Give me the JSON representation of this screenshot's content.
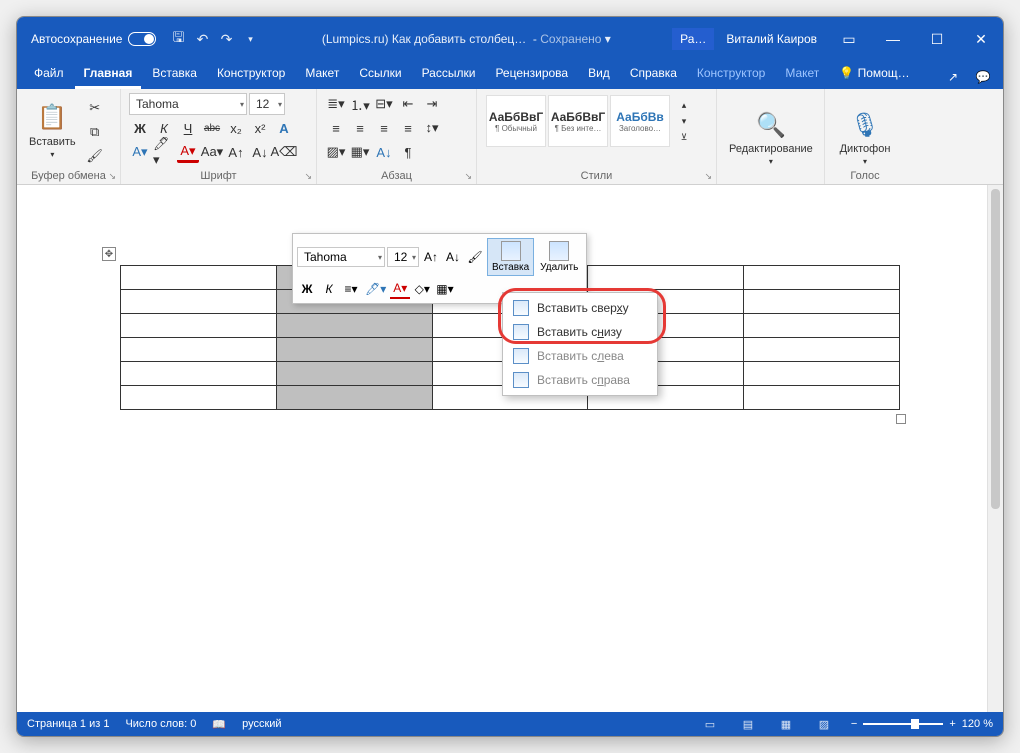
{
  "titlebar": {
    "autosave": "Автосохранение",
    "doc_title": "(Lumpics.ru) Как добавить столбец…",
    "saved": "Сохранено",
    "tag": "Ра…",
    "user": "Виталий Каиров"
  },
  "tabs": {
    "file": "Файл",
    "home": "Главная",
    "insert": "Вставка",
    "design": "Конструктор",
    "layout": "Макет",
    "references": "Ссылки",
    "mailings": "Рассылки",
    "review": "Рецензирова",
    "view": "Вид",
    "help": "Справка",
    "t_design": "Конструктор",
    "t_layout": "Макет",
    "tell_me": "Помощ…"
  },
  "ribbon": {
    "clipboard": {
      "label": "Буфер обмена",
      "paste": "Вставить"
    },
    "font": {
      "label": "Шрифт",
      "name": "Tahoma",
      "size": "12",
      "b": "Ж",
      "i": "К",
      "u": "Ч",
      "strike": "abc"
    },
    "para": {
      "label": "Абзац"
    },
    "styles": {
      "label": "Стили",
      "s1_sample": "АаБбВвГ",
      "s1_name": "¶ Обычный",
      "s2_sample": "АаБбВвГ",
      "s2_name": "¶ Без инте…",
      "s3_sample": "АаБбВв",
      "s3_name": "Заголово…"
    },
    "editing": {
      "label": "Редактирование"
    },
    "voice": {
      "label": "Голос",
      "btn": "Диктофон"
    }
  },
  "minitb": {
    "font": "Tahoma",
    "size": "12",
    "b": "Ж",
    "i": "К",
    "insert": "Вставка",
    "delete": "Удалить"
  },
  "dropdown": {
    "above": "Вставить сверху",
    "below": "Вставить снизу",
    "left": "Вставить слева",
    "right": "Вставить справа"
  },
  "statusbar": {
    "page": "Страница 1 из 1",
    "words": "Число слов: 0",
    "lang": "русский",
    "zoom": "120 %"
  }
}
